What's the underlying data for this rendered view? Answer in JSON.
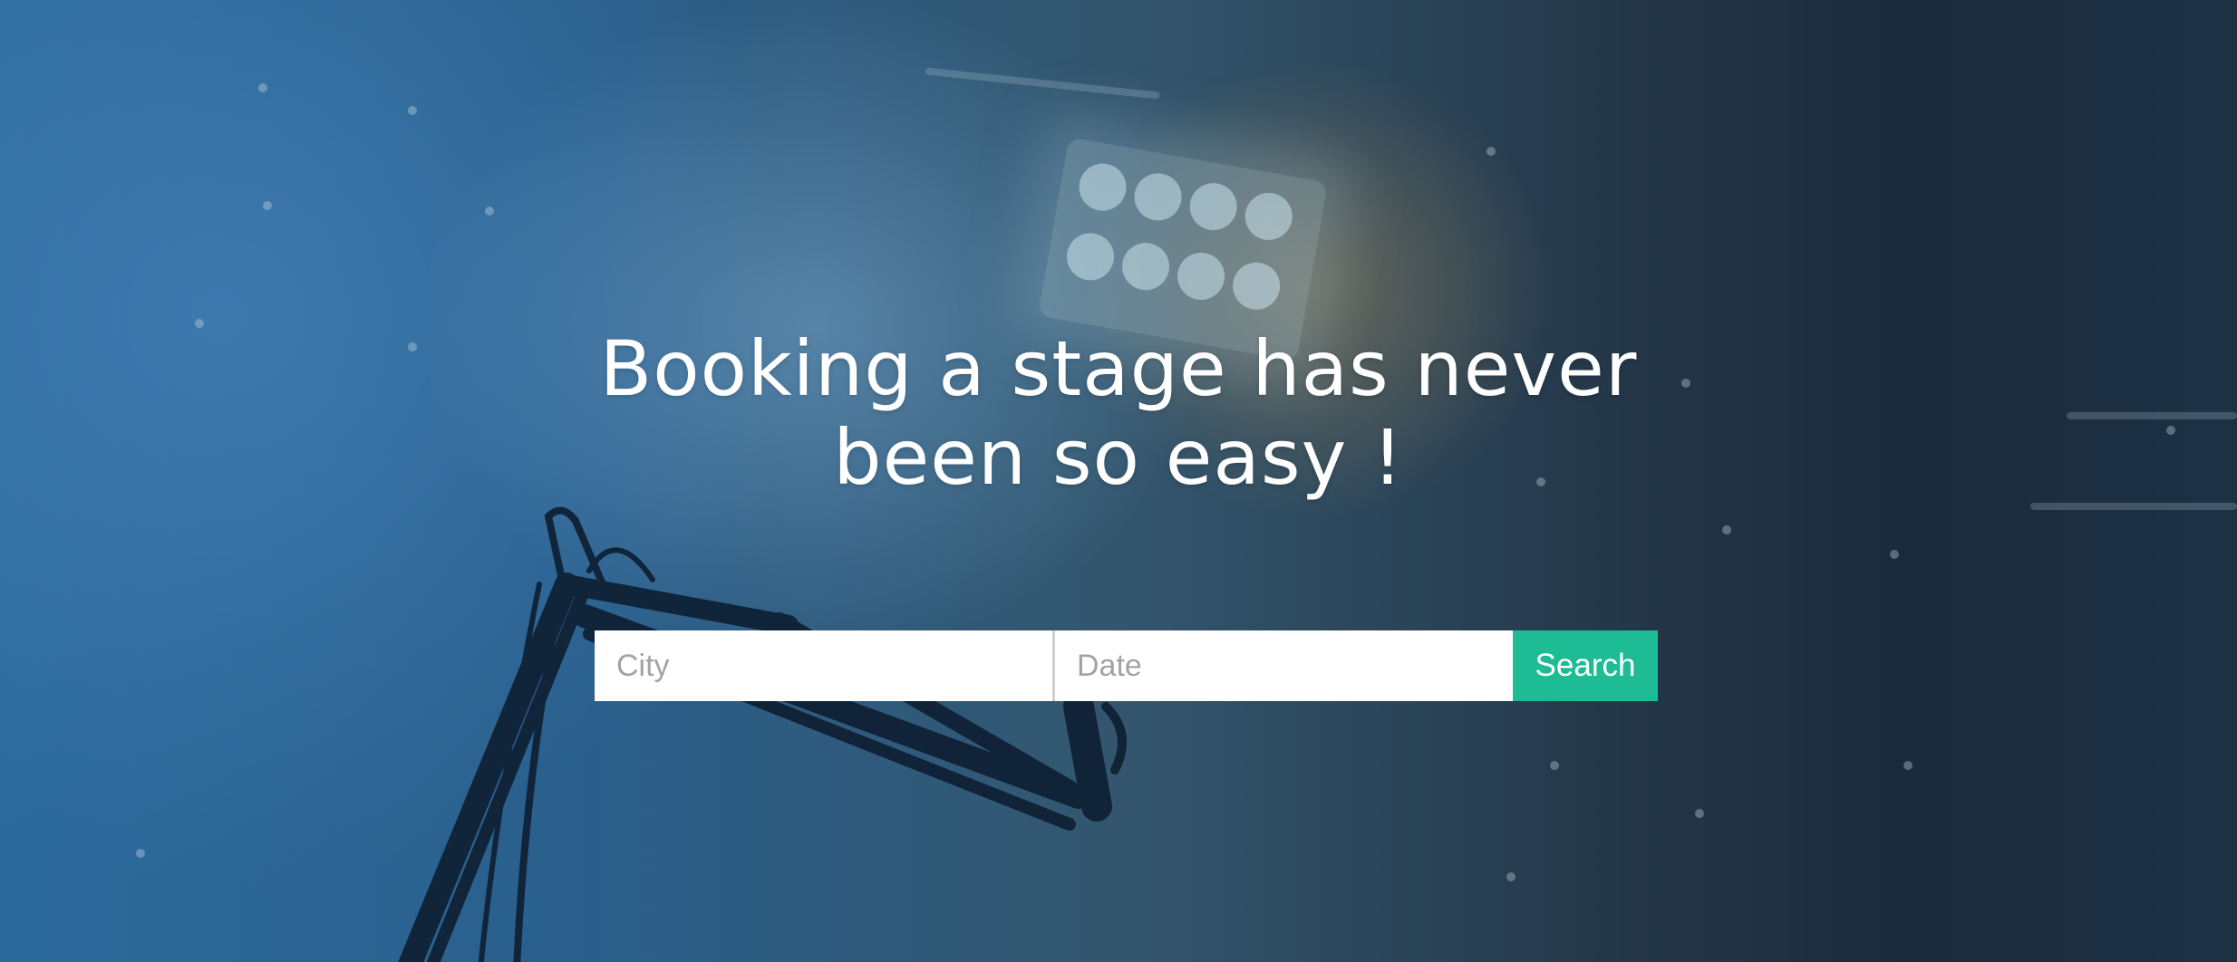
{
  "hero": {
    "headline_line1": "Booking a stage has never",
    "headline_line2": "been so easy !"
  },
  "search": {
    "city_placeholder": "City",
    "date_placeholder": "Date",
    "button_label": "Search"
  },
  "colors": {
    "accent": "#1dbc94",
    "headline": "#ffffff"
  }
}
